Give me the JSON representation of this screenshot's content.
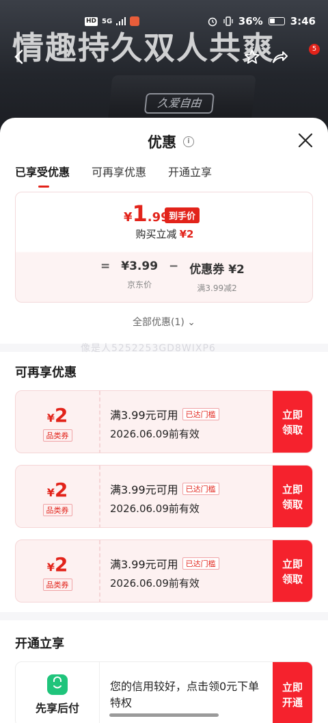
{
  "banner": {
    "title": "情趣持久双人共爽",
    "box_label": "久爱自由",
    "notification_count": "5"
  },
  "statusbar": {
    "hd": "HD",
    "net": "5G",
    "battery": "36%",
    "time": "3:46"
  },
  "sheet": {
    "title": "优惠",
    "tabs": [
      "已享受优惠",
      "可再享优惠",
      "开通立享"
    ],
    "summary": {
      "currency": "¥",
      "price_int": "1",
      "price_dec": ".99",
      "price_tag": "到手价",
      "save_label": "购买立减",
      "save_amount": "¥2",
      "eq": "=",
      "original_price": "¥3.99",
      "original_label": "京东价",
      "minus": "−",
      "coupon_label": "优惠券 ¥2",
      "coupon_rule": "满3.99减2"
    },
    "all_discounts": "全部优惠(1) ⌄",
    "watermark": "像是人5252253GD8WIXP6"
  },
  "reenjoy": {
    "title": "可再享优惠",
    "coupons": [
      {
        "sym": "¥",
        "amount": "2",
        "type": "品类券",
        "condition": "满3.99元可用",
        "badge": "已达门槛",
        "valid": "2026.06.09前有效",
        "btn": "立即\n领取"
      },
      {
        "sym": "¥",
        "amount": "2",
        "type": "品类券",
        "condition": "满3.99元可用",
        "badge": "已达门槛",
        "valid": "2026.06.09前有效",
        "btn": "立即\n领取"
      },
      {
        "sym": "¥",
        "amount": "2",
        "type": "品类券",
        "condition": "满3.99元可用",
        "badge": "已达门槛",
        "valid": "2026.06.09前有效",
        "btn": "立即\n领取"
      }
    ]
  },
  "open": {
    "title": "开通立享",
    "card": {
      "name": "先享后付",
      "text": "您的信用较好，点击领0元下单特权",
      "btn": "立即\n开通"
    }
  },
  "colors": {
    "accent": "#e2231a",
    "button": "#f5222d",
    "coupon_bg": "#fdf1f1",
    "green": "#1fc47b"
  }
}
